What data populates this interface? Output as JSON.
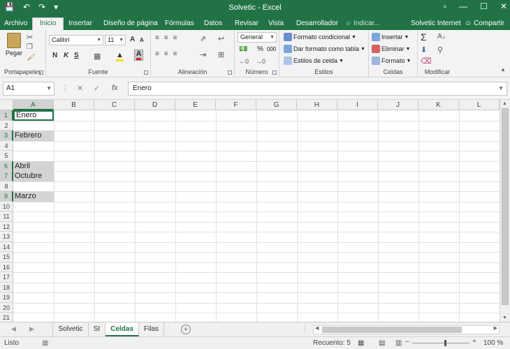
{
  "window": {
    "title": "Solvetic - Excel",
    "qat_save_icon": "save-icon",
    "qat_undo_icon": "undo-icon",
    "qat_redo_icon": "redo-icon",
    "qat_customize_icon": "customize-icon"
  },
  "ribbon_tabs": [
    {
      "label": "Archivo"
    },
    {
      "label": "Inicio"
    },
    {
      "label": "Insertar"
    },
    {
      "label": "Diseño de página"
    },
    {
      "label": "Fórmulas"
    },
    {
      "label": "Datos"
    },
    {
      "label": "Revisar"
    },
    {
      "label": "Vista"
    },
    {
      "label": "Desarrollador"
    }
  ],
  "tell_me": "Indicar...",
  "user": "Solvetic Internet",
  "share_label": "Compartir",
  "groups": {
    "portapapeles": {
      "label": "Portapapeles",
      "paste": "Pegar"
    },
    "fuente": {
      "label": "Fuente",
      "font_name": "Calibri",
      "font_size": "11",
      "bold": "N",
      "italic": "K",
      "underline": "S",
      "grow": "A",
      "shrink": "A",
      "font_color_btn": "A"
    },
    "alineacion": {
      "label": "Alineación"
    },
    "numero": {
      "label": "Número",
      "format": "General",
      "percent": "%",
      "comma": "000"
    },
    "estilos": {
      "label": "Estilos",
      "conditional": "Formato condicional",
      "as_table": "Dar formato como tabla",
      "cell_styles": "Estilos de celda"
    },
    "celdas": {
      "label": "Celdas",
      "insert": "Insertar",
      "delete": "Eliminar",
      "format": "Formato"
    },
    "modificar": {
      "label": "Modificar"
    }
  },
  "formula_bar": {
    "name_box": "A1",
    "fx": "fx",
    "content": "Enero"
  },
  "columns": [
    "A",
    "B",
    "C",
    "D",
    "E",
    "F",
    "G",
    "H",
    "I",
    "J",
    "K",
    "L"
  ],
  "rows": [
    "1",
    "2",
    "3",
    "4",
    "5",
    "6",
    "7",
    "8",
    "9",
    "10",
    "11",
    "12",
    "13",
    "14",
    "15",
    "16",
    "17",
    "18",
    "19",
    "20",
    "21"
  ],
  "cells": {
    "A1": "Enero",
    "A3": "Febrero",
    "A6": "Abril",
    "A7": "Octubre",
    "A9": "Marzo"
  },
  "sheet_tabs": [
    {
      "label": "Solvetic"
    },
    {
      "label": "SI"
    },
    {
      "label": "Celdas"
    },
    {
      "label": "Filas"
    }
  ],
  "status": {
    "mode": "Listo",
    "count": "Recuento: 5",
    "zoom": "100 %"
  }
}
